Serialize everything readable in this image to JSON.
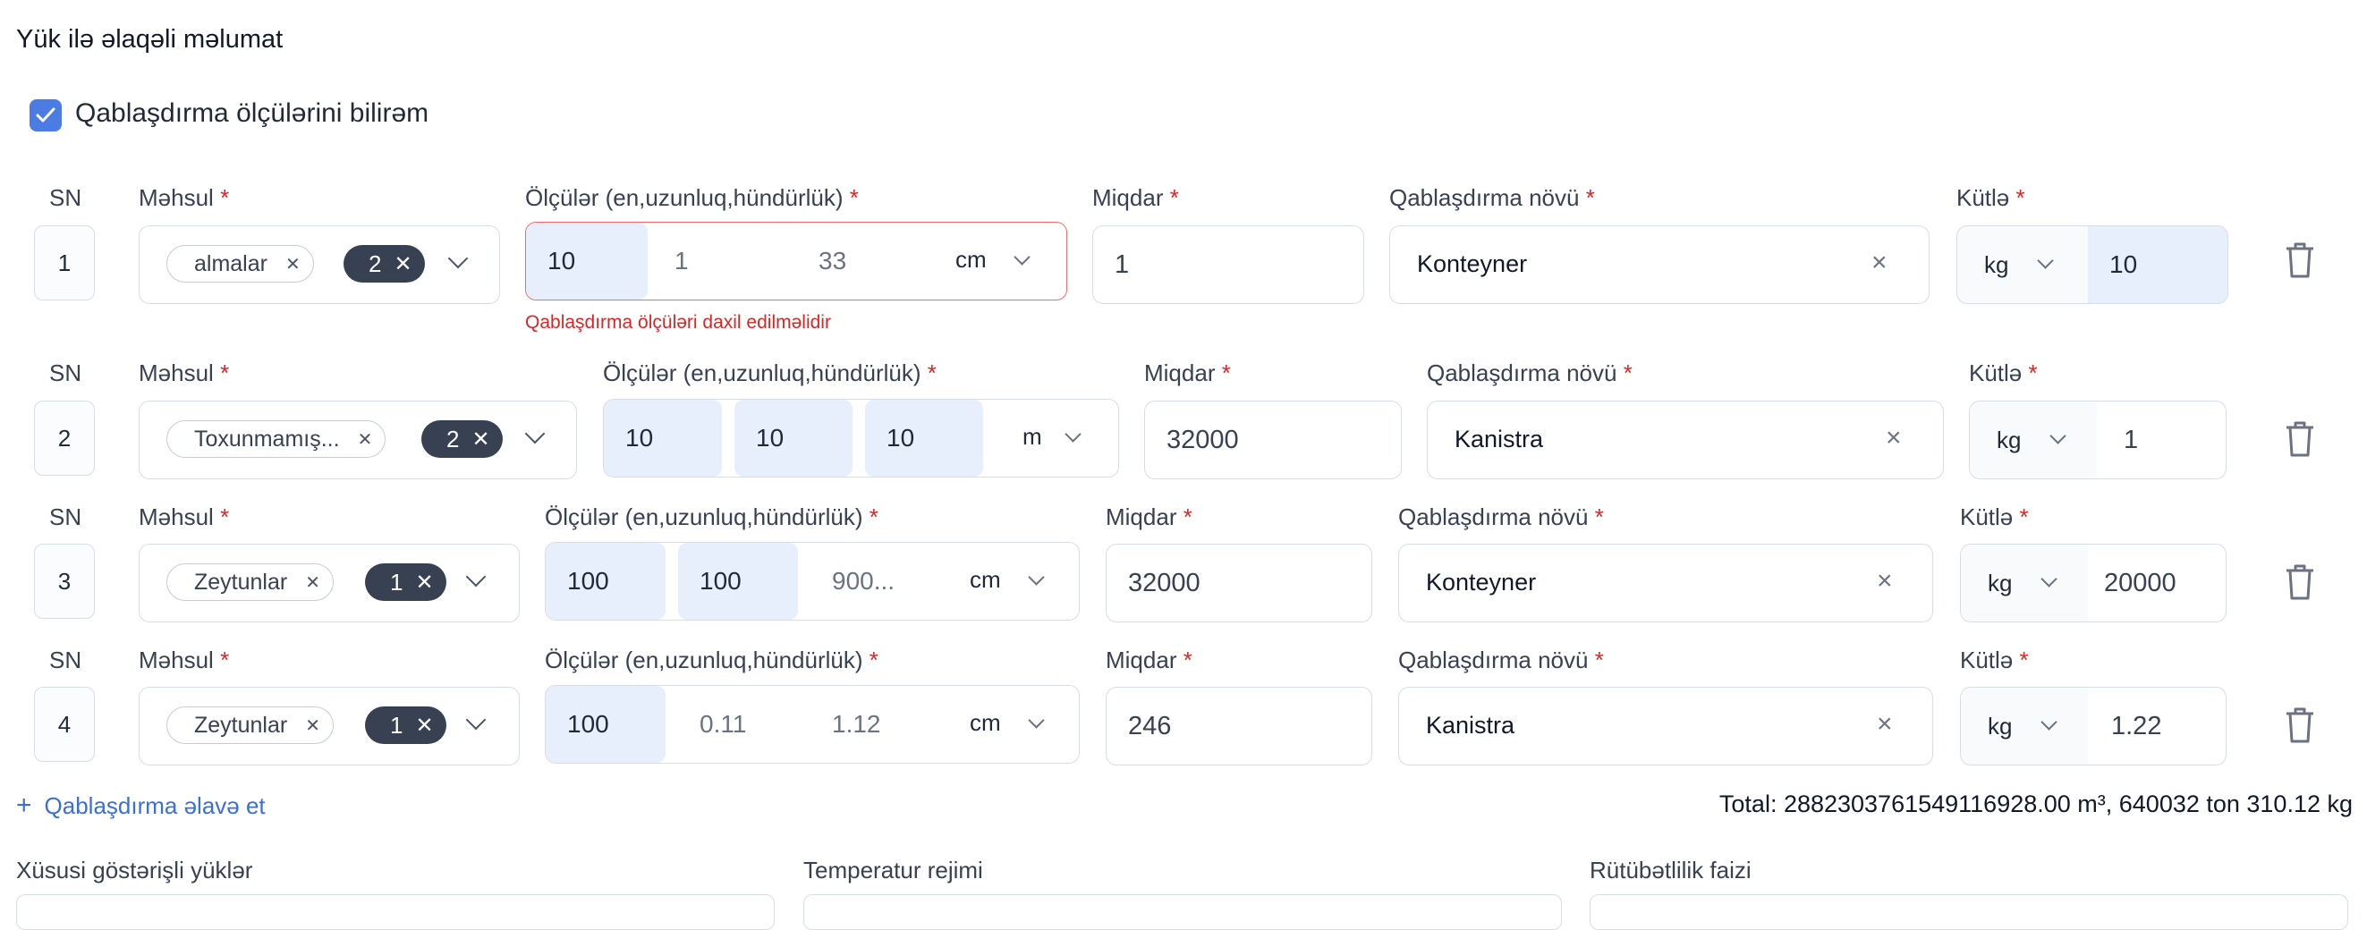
{
  "title": "Yük ilə əlaqəli məlumat",
  "checkbox_label": "Qablaşdırma ölçülərini bilirəm",
  "labels": {
    "sn": "SN",
    "product": "Məhsul",
    "dimensions": "Ölçülər (en,uzunluq,hündürlük)",
    "quantity": "Miqdar",
    "package_type": "Qablaşdırma növü",
    "weight": "Kütlə",
    "required": "*"
  },
  "rows": [
    {
      "sn": "1",
      "tag": "almalar",
      "count": "2",
      "dims": [
        "10",
        "1",
        "33"
      ],
      "dim_unit": "cm",
      "quantity": "1",
      "package": "Konteyner",
      "weight_unit": "kg",
      "weight": "10",
      "error": "Qablaşdırma ölçüləri daxil edilməlidir"
    },
    {
      "sn": "2",
      "tag": "Toxunmamış...",
      "count": "2",
      "dims": [
        "10",
        "10",
        "10"
      ],
      "dim_unit": "m",
      "quantity": "32000",
      "package": "Kanistra",
      "weight_unit": "kg",
      "weight": "1"
    },
    {
      "sn": "3",
      "tag": "Zeytunlar",
      "count": "1",
      "dims": [
        "100",
        "100",
        "900..."
      ],
      "dim_unit": "cm",
      "quantity": "32000",
      "package": "Konteyner",
      "weight_unit": "kg",
      "weight": "20000"
    },
    {
      "sn": "4",
      "tag": "Zeytunlar",
      "count": "1",
      "dims": [
        "100",
        "0.11",
        "1.12"
      ],
      "dim_unit": "cm",
      "quantity": "246",
      "package": "Kanistra",
      "weight_unit": "kg",
      "weight": "1.22"
    }
  ],
  "add_label": "Qablaşdırma əlavə et",
  "add_icon": "+",
  "clear_icon": "×",
  "total": "Total: 2882303761549116928.00 m³, 640032 ton 310.12 kg",
  "bottom_labels": [
    "Xüsusi göstərişli yüklər",
    "Temperatur rejimi",
    "Rütübətlilik faizi"
  ],
  "colors": {
    "accent": "#4a7ce3",
    "error": "#dc2626",
    "highlight": "#e8effc",
    "pill": "#374151"
  }
}
